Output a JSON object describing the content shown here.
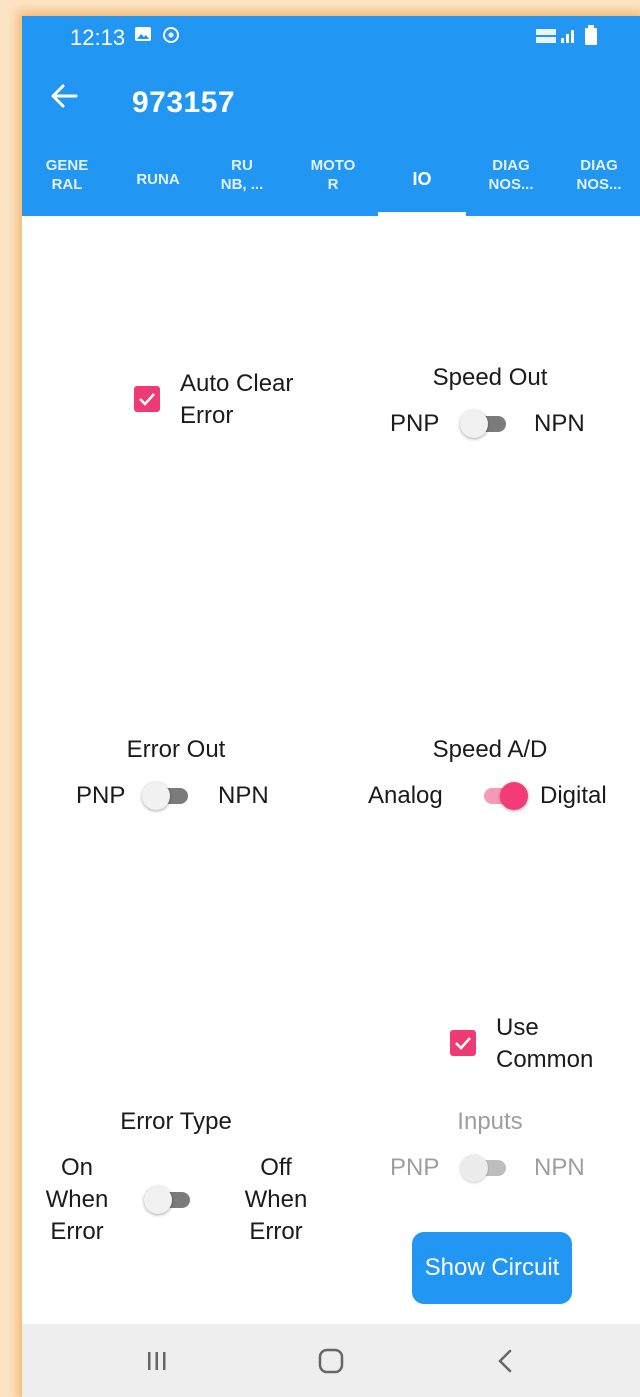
{
  "status": {
    "time": "12:13",
    "left_icons": [
      "image-icon",
      "sync-icon"
    ],
    "right_icons": [
      "volte-icon",
      "signal-icon",
      "battery-icon"
    ]
  },
  "appbar": {
    "title": "973157"
  },
  "tabs": [
    {
      "label": "GENE\nRAL"
    },
    {
      "label": "RUNA"
    },
    {
      "label": "RU\nNB, ..."
    },
    {
      "label": "MOTO\nR"
    },
    {
      "label": "IO",
      "active": true
    },
    {
      "label": "DIAG\nNOS..."
    },
    {
      "label": "DIAG\nNOS..."
    }
  ],
  "auto_clear": {
    "label": "Auto Clear\nError",
    "checked": true
  },
  "speed_out": {
    "title": "Speed Out",
    "left": "PNP",
    "right": "NPN",
    "on": false
  },
  "error_out": {
    "title": "Error Out",
    "left": "PNP",
    "right": "NPN",
    "on": false
  },
  "speed_ad": {
    "title": "Speed A/D",
    "left": "Analog",
    "right": "Digital",
    "on": true
  },
  "use_common": {
    "label": "Use\nCommon",
    "checked": true
  },
  "error_type": {
    "title": "Error Type",
    "left": "On\nWhen\nError",
    "right": "Off\nWhen\nError",
    "on": false
  },
  "inputs": {
    "title": "Inputs",
    "left": "PNP",
    "right": "NPN",
    "on": false,
    "disabled": true
  },
  "show_circuit": {
    "label": "Show Circuit"
  },
  "colors": {
    "primary": "#2196f3",
    "accent": "#ef3b73"
  }
}
